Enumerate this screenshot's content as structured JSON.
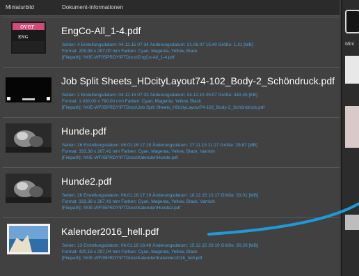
{
  "header": {
    "col_thumb": "Miniaturbild",
    "col_info": "Dokument-Informationen"
  },
  "documents": [
    {
      "name": "EngCo-All_1-4.pdf",
      "line1": "Seiten: 4 Erstellungsdatum: 04.12.15 07:34 Änderungsdatum: 21.08.07 15:40 Größe: 1,21 [MB]",
      "line2": "Format: 209,98 x 297,00 mm Farben: Cyan, Magenta, Yellow, Black",
      "line3": "[Filepath]: \\\\KIE-WF05PRDY\\PTDocs\\EngCo-All_1-4.pdf",
      "thumb_text": "over"
    },
    {
      "name": "Job Split Sheets_HDcityLayout74-102_Body-2_Schöndruck.pdf",
      "line1": "Seiten: 1 Erstellungsdatum: 04.12.15 07:33 Änderungsdatum: 04.12.15 05:07 Größe: 449,45 [KB]",
      "line2": "Format: 1.030,00 x 790,00 mm Farben: Cyan, Magenta, Yellow, Black",
      "line3": "[Filepath]: \\\\KIE-WF05PRDY\\PTDocs\\Job Split Sheets_HDcityLayout74-102_Body-2_Schöndruck.pdf"
    },
    {
      "name": "Hunde.pdf",
      "line1": "Seiten: 26 Erstellungsdatum: 06.01.16 17:18 Änderungsdatum: 27.11.15 11:27 Größe: 29,87 [MB]",
      "line2": "Format: 333,38 x 267,41 mm Farben: Cyan, Magenta, Yellow, Black, Varnish",
      "line3": "[Filepath]: \\\\KIE-WF05PRDY\\PTDocs\\Kalender\\Hunde.pdf"
    },
    {
      "name": "Hunde2.pdf",
      "line1": "Seiten: 26 Erstellungsdatum: 06.01.16 17:19 Änderungsdatum: 18.12.15 10:17 Größe: 33,01 [MB]",
      "line2": "Format: 333,38 x 267,41 mm Farben: Cyan, Magenta, Yellow, Black, Varnish",
      "line3": "[Filepath]: \\\\KIE-WF05PRDY\\PTDocs\\Kalender\\Hunde2.pdf"
    },
    {
      "name": "Kalender2016_hell.pdf",
      "line1": "Seiten: 13 Erstellungsdatum: 06.01.16 16:48 Änderungsdatum: 15.12.15 20:10 Größe: 30,26 [MB]",
      "line2": "Format: 420,16 x 297,04 mm Farben: Cyan, Magenta, Yellow, Black",
      "line3": "[Filepath]: \\\\KIE-WF05PRDY\\PTDocs\\Kalender\\Kalender2016_hell.pdf"
    }
  ],
  "right_pane": {
    "label": "Mini"
  },
  "colors": {
    "meta_text": "#4aa3e0",
    "curve": "#1e9ad6"
  }
}
